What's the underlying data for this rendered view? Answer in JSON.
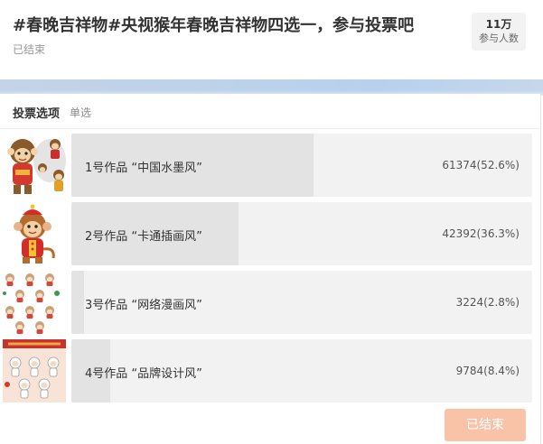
{
  "header": {
    "title": "#春晚吉祥物#央视猴年春晚吉祥物四选一，参与投票吧",
    "status": "已结束",
    "participants_value": "11万",
    "participants_label": "参与人数"
  },
  "panel": {
    "title": "投票选项",
    "mode": "单选"
  },
  "options": [
    {
      "label": "1号作品 “中国水墨风”",
      "count_text": "61374(52.6%)",
      "percent": 52.6,
      "thumb_icon": "ink-monkey-image"
    },
    {
      "label": "2号作品 “卡通插画风”",
      "count_text": "42392(36.3%)",
      "percent": 36.3,
      "thumb_icon": "cartoon-monkey-image"
    },
    {
      "label": "3号作品 “网络漫画风”",
      "count_text": "3224(2.8%)",
      "percent": 2.8,
      "thumb_icon": "comic-monkey-grid-image"
    },
    {
      "label": "4号作品 “品牌设计风”",
      "count_text": "9784(8.4%)",
      "percent": 8.4,
      "thumb_icon": "brand-monkey-poster-image"
    }
  ],
  "footer": {
    "ended_label": "已结束"
  },
  "colors": {
    "bar_bg": "#f2f2f2",
    "bar_fill": "#e3e3e3",
    "ended_button": "#f9c3a8",
    "band": "#bfd2ea"
  }
}
